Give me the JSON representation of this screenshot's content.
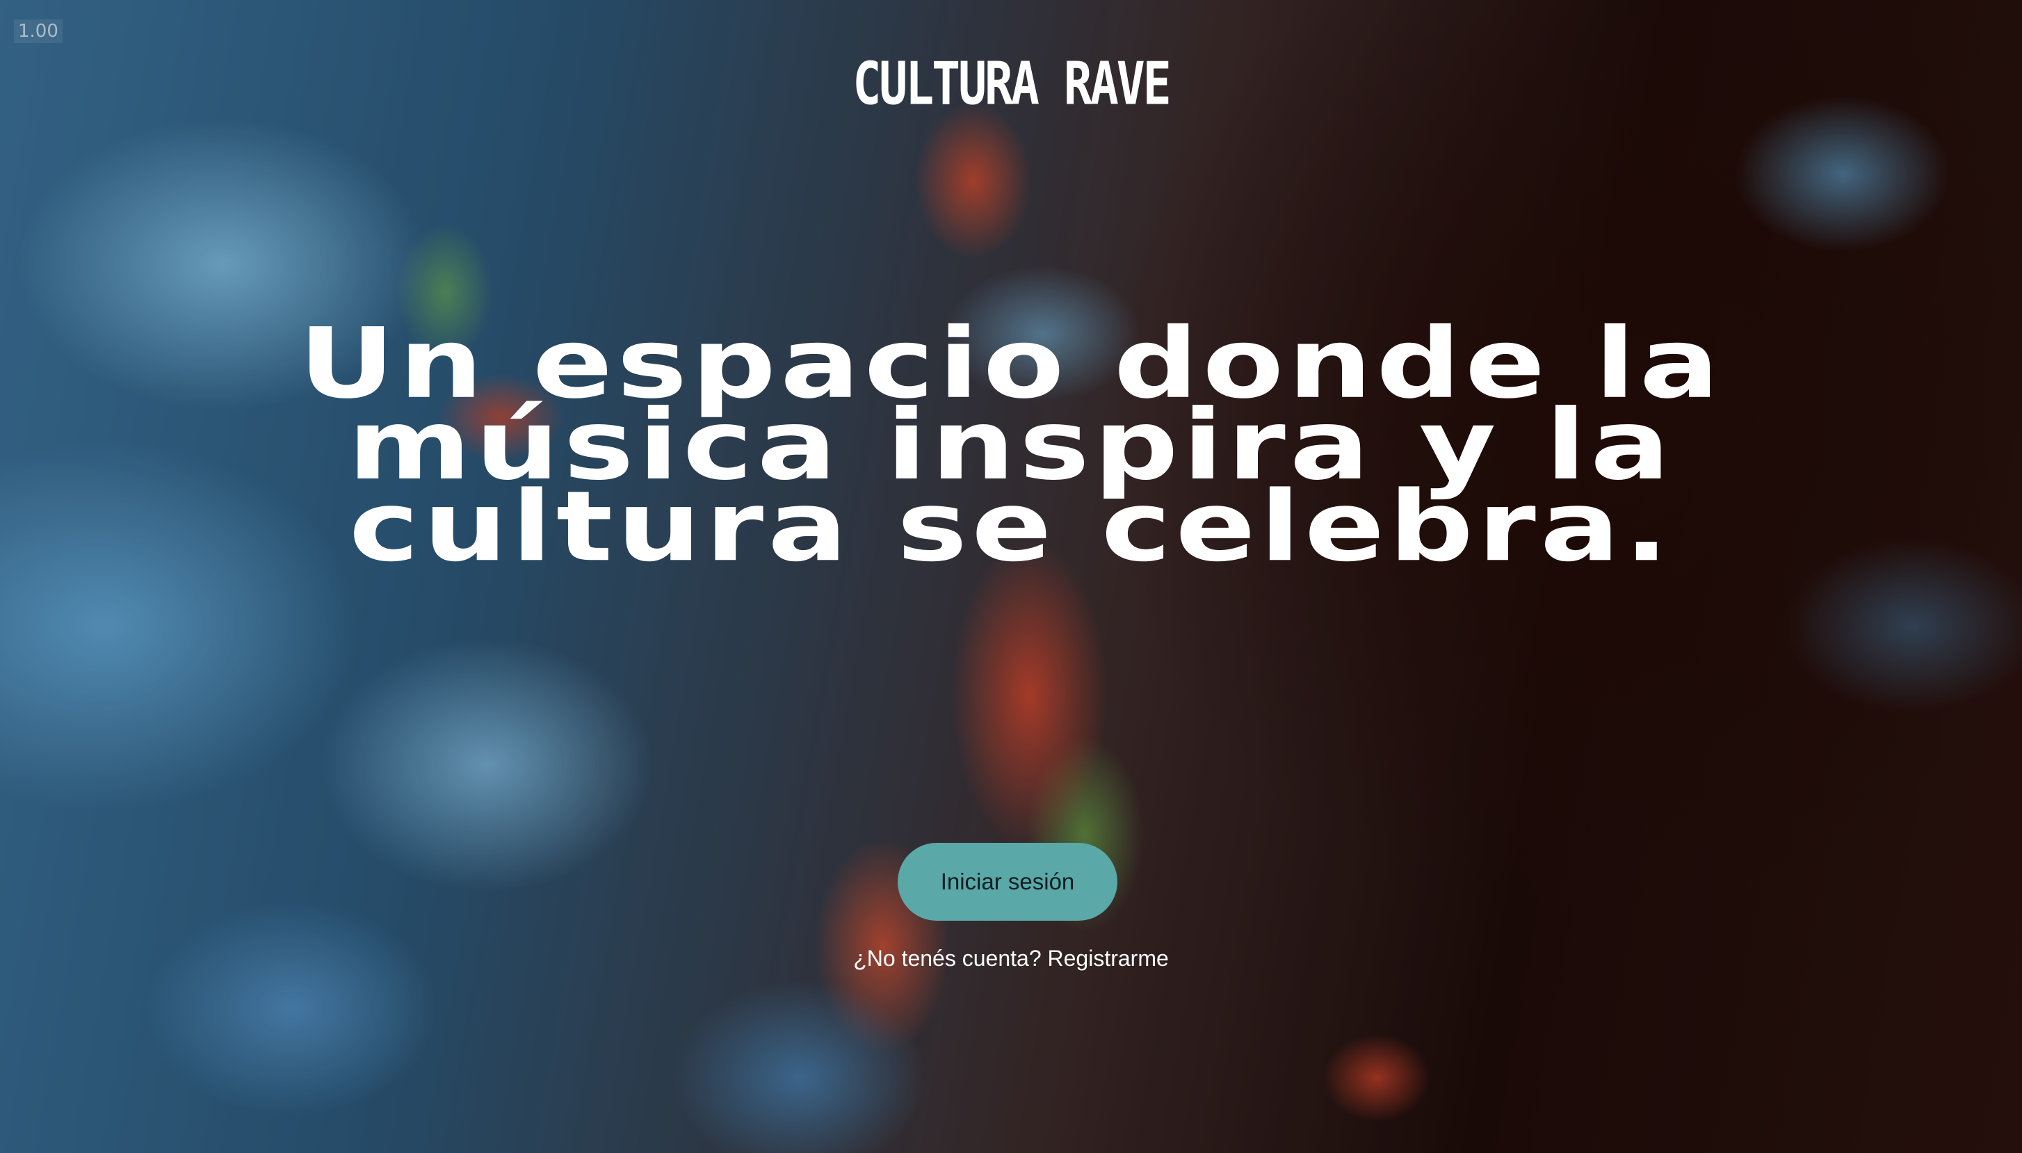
{
  "viewer": {
    "zoom_level": "1.00"
  },
  "brand": {
    "logo_text": "CULTURA RAVE"
  },
  "hero": {
    "headline_lines": [
      "Un espacio donde la",
      "música inspira y la",
      "cultura se celebra."
    ]
  },
  "auth": {
    "login_label": "Iniciar sesión",
    "register_prompt": "¿No tenés cuenta?",
    "register_link": "Registrarme"
  },
  "colors": {
    "button_bg": "#5aa8a8",
    "text": "#ffffff"
  }
}
